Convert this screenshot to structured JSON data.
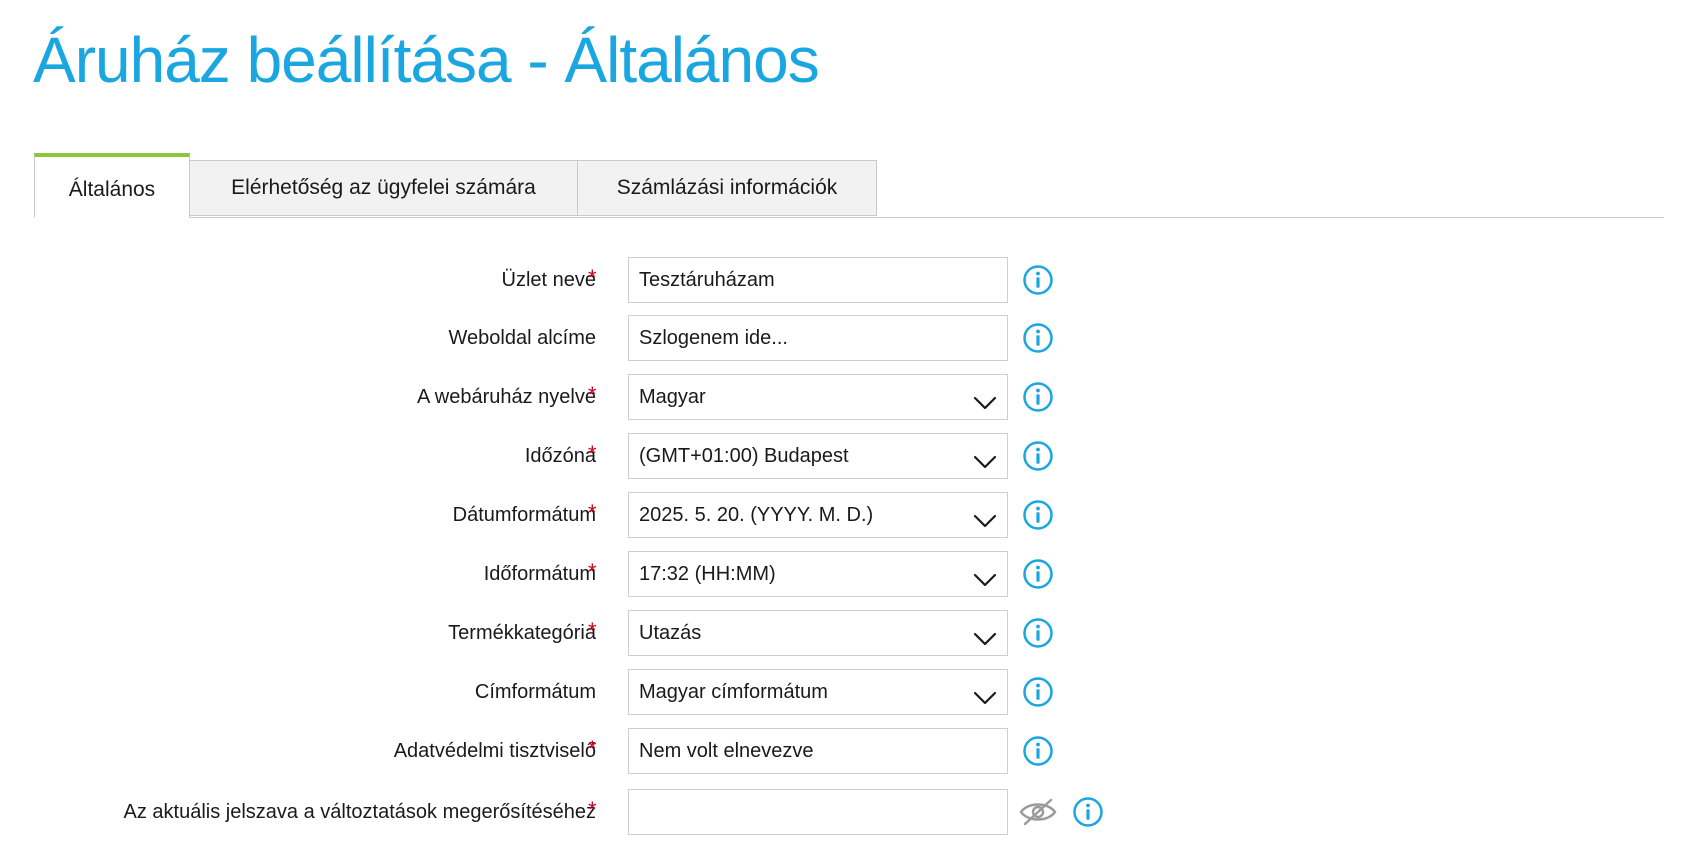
{
  "page": {
    "title": "Áruház beállítása - Általános"
  },
  "tabs": [
    {
      "label": "Általános",
      "active": true
    },
    {
      "label": "Elérhetőség az ügyfelei számára",
      "active": false
    },
    {
      "label": "Számlázási információk",
      "active": false
    }
  ],
  "form": {
    "rows": [
      {
        "label": "Üzlet neve",
        "required": true,
        "type": "text",
        "value": "Tesztáruházam"
      },
      {
        "label": "Weboldal alcíme",
        "required": false,
        "type": "text",
        "value": "Szlogenem ide..."
      },
      {
        "label": "A webáruház nyelve",
        "required": true,
        "type": "select",
        "value": "Magyar"
      },
      {
        "label": "Időzóna",
        "required": true,
        "type": "select",
        "value": "(GMT+01:00) Budapest"
      },
      {
        "label": "Dátumformátum",
        "required": true,
        "type": "select",
        "value": "2025. 5. 20. (YYYY. M. D.)"
      },
      {
        "label": "Időformátum",
        "required": true,
        "type": "select",
        "value": "17:32 (HH:MM)"
      },
      {
        "label": "Termékkategória",
        "required": true,
        "type": "select",
        "value": "Utazás"
      },
      {
        "label": "Címformátum",
        "required": false,
        "type": "select",
        "value": "Magyar címformátum"
      },
      {
        "label": "Adatvédelmi tisztviselő",
        "required": true,
        "type": "text",
        "value": "Nem volt elnevezve"
      },
      {
        "label": "Az aktuális jelszava a változtatások megerősítéséhez",
        "required": true,
        "type": "password",
        "value": ""
      }
    ],
    "required_marker": "*"
  },
  "icons": {
    "info": "info-circle-icon",
    "chevron": "chevron-down-icon",
    "password_toggle": "eye-slash-icon"
  },
  "colors": {
    "title": "#1aa6e0",
    "info_icon": "#1aa6e0",
    "active_tab_accent": "#8cc63f",
    "required": "#d0021b",
    "border": "#cfcfcf",
    "eye_icon": "#9a9a9a"
  }
}
